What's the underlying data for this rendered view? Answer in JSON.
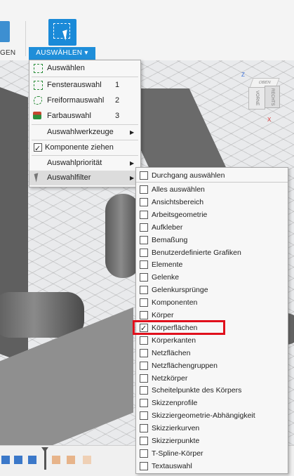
{
  "toolbar": {
    "left_label": "GEN",
    "select_button_label": "AUSWÄHLEN"
  },
  "main_menu": {
    "items": [
      {
        "label": "Auswählen",
        "key": ""
      },
      {
        "label": "Fensterauswahl",
        "key": "1"
      },
      {
        "label": "Freiformauswahl",
        "key": "2"
      },
      {
        "label": "Farbauswahl",
        "key": "3"
      },
      {
        "label": "Auswahlwerkzeuge",
        "key": ""
      },
      {
        "label": "Komponente ziehen",
        "key": ""
      },
      {
        "label": "Auswahlpriorität",
        "key": ""
      },
      {
        "label": "Auswahlfilter",
        "key": ""
      }
    ]
  },
  "filter_menu": {
    "items": [
      {
        "label": "Durchgang auswählen",
        "checked": false
      },
      {
        "label": "Alles auswählen",
        "checked": false
      },
      {
        "label": "Ansichtsbereich",
        "checked": false
      },
      {
        "label": "Arbeitsgeometrie",
        "checked": false
      },
      {
        "label": "Aufkleber",
        "checked": false
      },
      {
        "label": "Bemaßung",
        "checked": false
      },
      {
        "label": "Benutzerdefinierte Grafiken",
        "checked": false
      },
      {
        "label": "Elemente",
        "checked": false
      },
      {
        "label": "Gelenke",
        "checked": false
      },
      {
        "label": "Gelenkursprünge",
        "checked": false
      },
      {
        "label": "Komponenten",
        "checked": false
      },
      {
        "label": "Körper",
        "checked": false
      },
      {
        "label": "Körperflächen",
        "checked": true
      },
      {
        "label": "Körperkanten",
        "checked": false
      },
      {
        "label": "Netzflächen",
        "checked": false
      },
      {
        "label": "Netzflächengruppen",
        "checked": false
      },
      {
        "label": "Netzkörper",
        "checked": false
      },
      {
        "label": "Scheitelpunkte des Körpers",
        "checked": false
      },
      {
        "label": "Skizzenprofile",
        "checked": false
      },
      {
        "label": "Skizziergeometrie-Abhängigkeit",
        "checked": false
      },
      {
        "label": "Skizzierkurven",
        "checked": false
      },
      {
        "label": "Skizzierpunkte",
        "checked": false
      },
      {
        "label": "T-Spline-Körper",
        "checked": false
      },
      {
        "label": "Textauswahl",
        "checked": false
      }
    ]
  },
  "viewcube": {
    "top": "OBEN",
    "front": "VORNE",
    "right": "RECHTS",
    "axis_z": "Z",
    "axis_x": "X"
  },
  "icons": [
    "select-icon",
    "window-select-icon",
    "freeform-select-icon",
    "paint-select-icon",
    "cursor-icon",
    "gear-icon"
  ],
  "colors": {
    "accent": "#1f8ed9",
    "highlight": "#e0101c"
  }
}
